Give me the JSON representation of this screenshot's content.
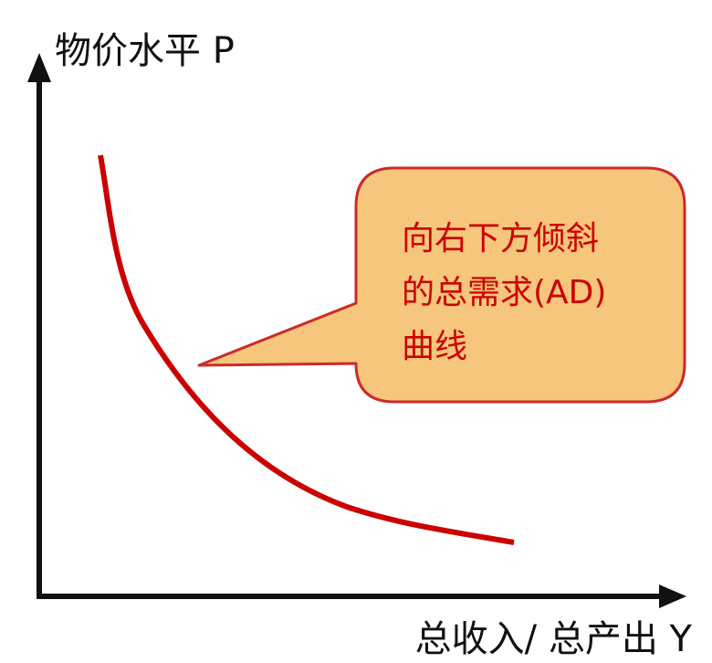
{
  "y_axis_label": "物价水平 P",
  "x_axis_label": "总收入/ 总产出 Y",
  "callout": {
    "lines": [
      "向右下方倾斜",
      "的总需求(AD)",
      "曲线"
    ]
  },
  "colors": {
    "curve": "#cc0000",
    "callout_fill": "#f5c67b",
    "callout_border": "#cc2a2a",
    "callout_text": "#cc0000",
    "axis": "#111111"
  }
}
